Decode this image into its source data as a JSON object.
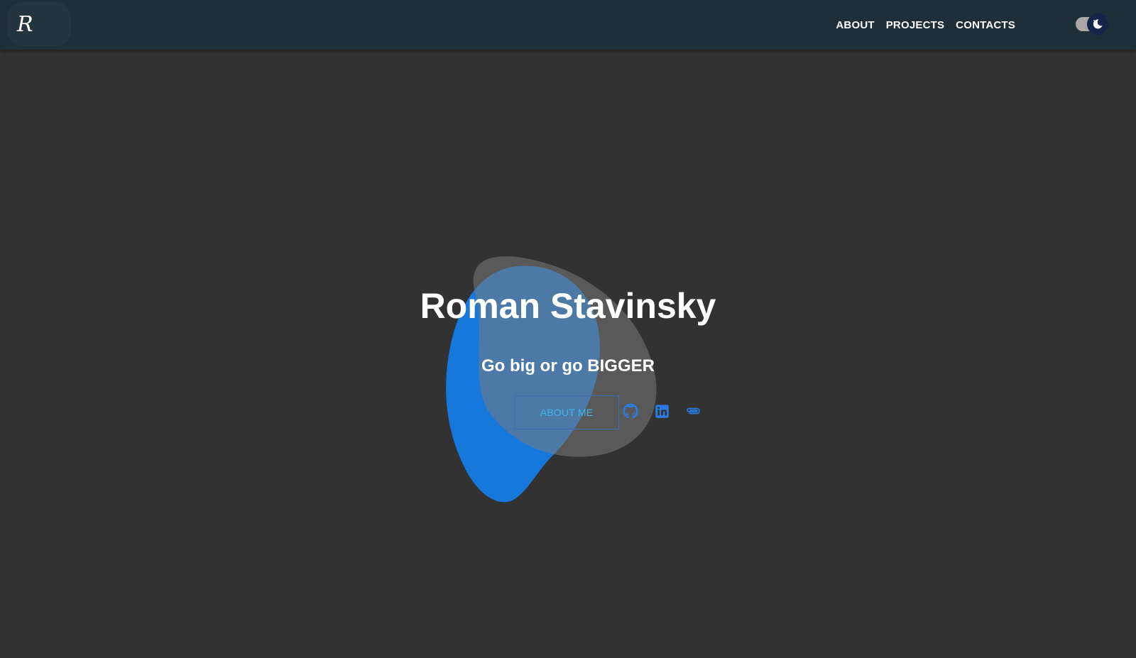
{
  "navbar": {
    "logo": "R",
    "links": [
      "ABOUT",
      "PROJECTS",
      "CONTACTS"
    ],
    "theme_toggle": {
      "icon": "moon-icon",
      "state": "dark"
    }
  },
  "hero": {
    "title": "Roman Stavinsky",
    "subtitle": "Go big or go BIGGER",
    "button_label": "ABOUT ME",
    "social_icons": [
      "github-icon",
      "linkedin-icon",
      "paperclip-icon"
    ]
  },
  "colors": {
    "background": "#323232",
    "navbar": "#1e2f3a",
    "blob_blue": "#1778dc",
    "blob_gray": "#4a4a4a",
    "accent": "#3fb8ea",
    "icon_blue": "#2a7de0"
  }
}
